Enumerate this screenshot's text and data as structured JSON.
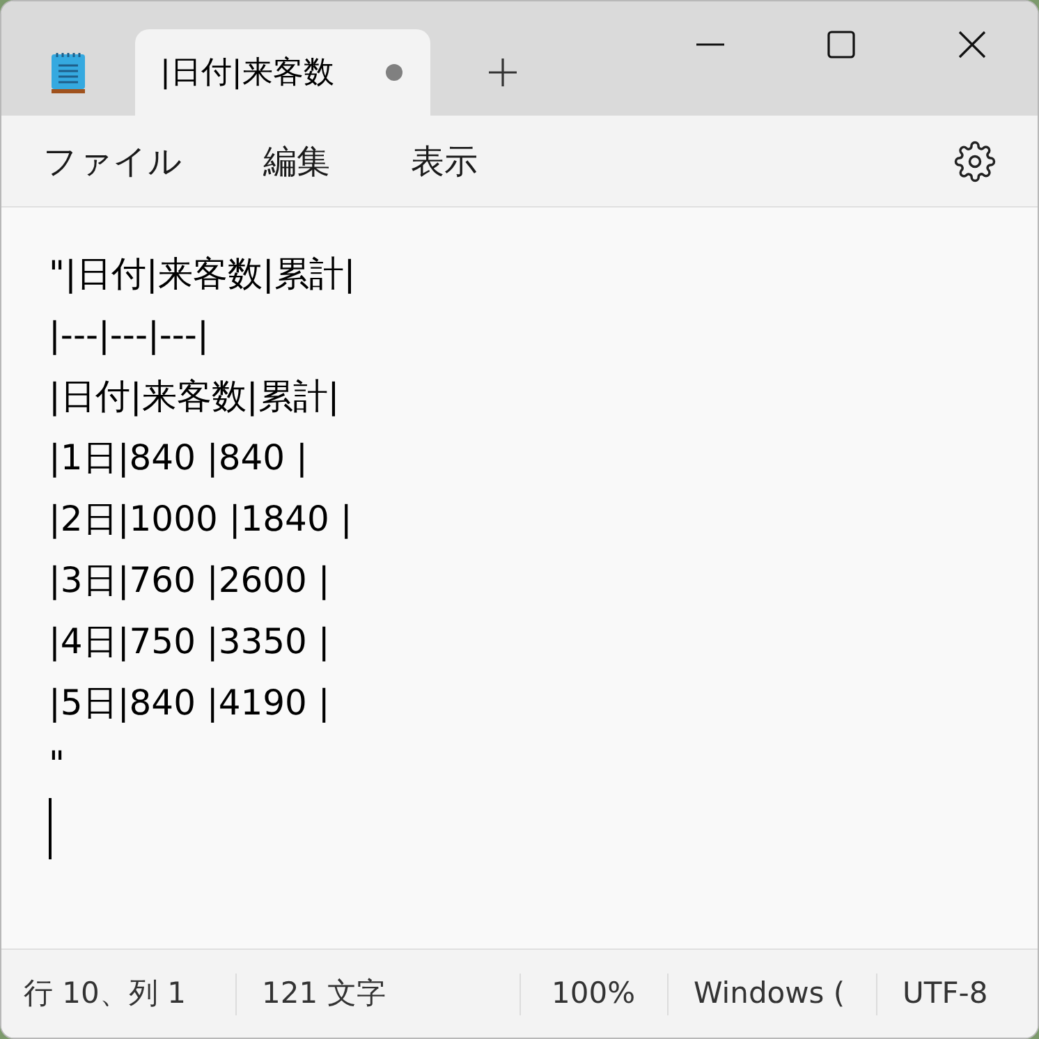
{
  "tab": {
    "title": "|日付|来客数",
    "modified": true
  },
  "menu": [
    "ファイル",
    "編集",
    "表示"
  ],
  "editor": {
    "lines": [
      "\"|日付|来客数|累計|",
      "|---|---|---|",
      "|日付|来客数|累計|",
      "|1日|840 |840 |",
      "|2日|1000 |1840 |",
      "|3日|760 |2600 |",
      "|4日|750 |3350 |",
      "|5日|840 |4190 |",
      "\""
    ]
  },
  "status_bar": [
    {
      "text": "行 10、列 1"
    },
    {
      "text": "121 文字"
    },
    {
      "text": "100%"
    },
    {
      "text": "Windows ("
    },
    {
      "text": "UTF-8"
    }
  ]
}
